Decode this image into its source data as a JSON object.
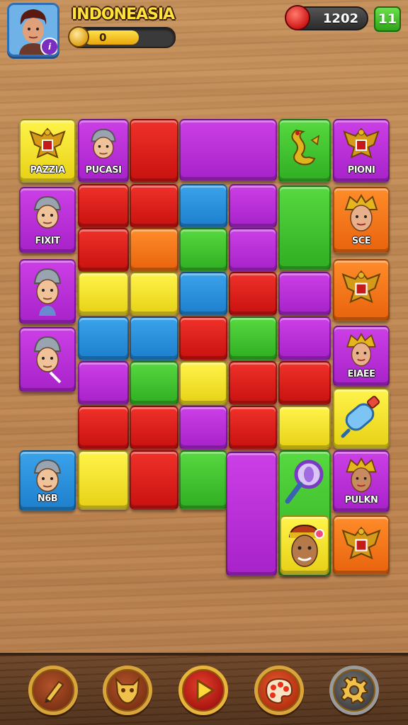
{
  "header": {
    "country": "INDONEASIA",
    "progress_value": "0",
    "progress_fraction": 0.63,
    "score": "1202",
    "moves": "11",
    "avatar_badge": "i"
  },
  "colors": {
    "red": "#e0221d",
    "purple": "#b72fd8",
    "green": "#3fc22e",
    "blue": "#2a90dd",
    "yellow": "#f4e22c",
    "orange": "#f27618"
  },
  "tiles": {
    "c0r0": "PAZZIA",
    "c1r0": "PUCASI",
    "c5r0": "PIONI",
    "c0r1": "FIXIT",
    "c5r1": "SCE",
    "c5r3": "EIAEE",
    "c0r6": "N6B",
    "c5r6": "PULKN"
  },
  "icons": {
    "avatar": "player-portrait-icon",
    "coin": "coin-icon",
    "score": "target-icon",
    "garuda": "garuda-emblem-icon",
    "villager": "villager-face-icon",
    "dragon": "dragon-icon",
    "bottle": "bottle-icon",
    "magnifier": "magnifier-icon",
    "performer": "performer-face-icon",
    "pencil": "pencil-icon",
    "mask": "mask-icon",
    "play": "play-icon",
    "palette": "palette-icon",
    "gear": "gear-icon"
  }
}
